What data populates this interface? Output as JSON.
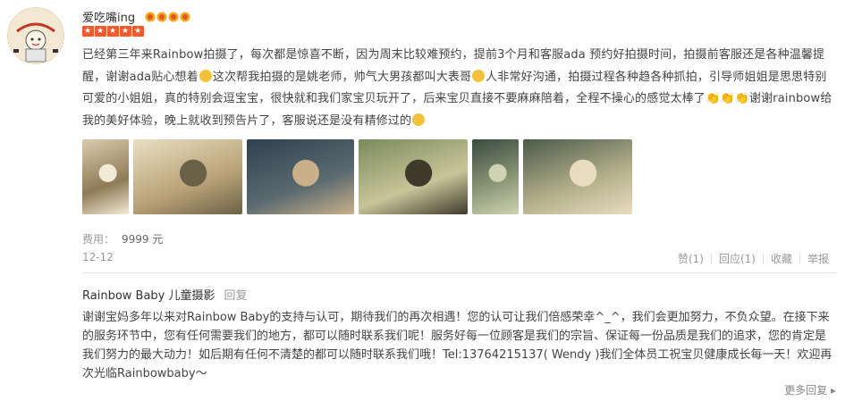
{
  "user": {
    "name": "爱吃嘴ing"
  },
  "vip_badge_count": 4,
  "rating": 5,
  "review_text_part1": "已经第三年来Rainbow拍摄了，每次都是惊喜不断，因为周末比较难预约，提前3个月和客服ada 预约好拍摄时间，拍摄前客服还是各种温馨提醒，谢谢ada贴心想着",
  "review_text_part2": "这次帮我拍摄的是姚老师，帅气大男孩都叫大表哥",
  "review_text_part3": "人非常好沟通，拍摄过程各种趋各种抓拍，引导师姐姐是思思特别可爱的小姐姐，真的特别会逗宝宝，很快就和我们家宝贝玩开了，后来宝贝直接不要麻麻陪着，全程不操心的感觉太棒了",
  "review_text_part4": "谢谢rainbow给我的美好体验，晚上就收到预告片了，客服说还是没有精修过的",
  "photos": [
    {
      "label": "photo-1",
      "w": 52,
      "colors": [
        "#d9ccae",
        "#8f7a56",
        "#f3ead6"
      ]
    },
    {
      "label": "photo-2",
      "w": 122,
      "colors": [
        "#e9dfc3",
        "#b9a176",
        "#6b6148"
      ]
    },
    {
      "label": "photo-3",
      "w": 120,
      "colors": [
        "#2f4150",
        "#5b6a70",
        "#c9b08a"
      ]
    },
    {
      "label": "photo-4",
      "w": 122,
      "colors": [
        "#7a8a5a",
        "#c8c59a",
        "#3d3a2c"
      ]
    },
    {
      "label": "photo-5",
      "w": 52,
      "colors": [
        "#3a4a3f",
        "#8d9b7a",
        "#cfd3b2"
      ]
    },
    {
      "label": "photo-6",
      "w": 122,
      "colors": [
        "#4a5a4a",
        "#b7b28d",
        "#e8dcc0"
      ]
    }
  ],
  "fee": {
    "label": "费用：",
    "value": "9999 元"
  },
  "date": "12-12",
  "actions": {
    "like": "赞(1)",
    "reply": "回应(1)",
    "collect": "收藏",
    "report": "举报"
  },
  "merchant": {
    "name": "Rainbow Baby 儿童摄影",
    "reply_label": "回复"
  },
  "reply_text": "谢谢宝妈多年以来对Rainbow Baby的支持与认可，期待我们的再次相遇！您的认可让我们倍感荣幸^_^，我们会更加努力，不负众望。在接下来的服务环节中，您有任何需要我们的地方，都可以随时联系我们呢！服务好每一位顾客是我们的宗旨、保证每一份品质是我们的追求，您的肯定是我们努力的最大动力！如后期有任何不清楚的都可以随时联系我们哦！Tel:13764215137( Wendy )我们全体员工祝宝贝健康成长每一天！欢迎再次光临Rainbowbaby～",
  "more_replies": "更多回复 ▸",
  "colors": {
    "star": "#f55a2c",
    "emoji": "#f2c23a"
  }
}
